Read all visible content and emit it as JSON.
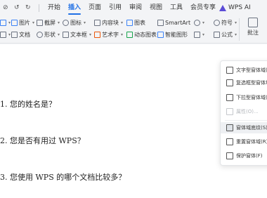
{
  "tabbar": {
    "quick_access": [
      "⊘",
      "↺",
      "↻"
    ],
    "tabs": [
      {
        "label": "开始",
        "active": false
      },
      {
        "label": "插入",
        "active": true
      },
      {
        "label": "页面",
        "active": false
      },
      {
        "label": "引用",
        "active": false
      },
      {
        "label": "审阅",
        "active": false
      },
      {
        "label": "视图",
        "active": false
      },
      {
        "label": "工具",
        "active": false
      },
      {
        "label": "会员专享",
        "active": false
      }
    ],
    "ai_label": "WPS AI"
  },
  "ribbon": {
    "picture": "图片",
    "screenshot": "截屏",
    "icons": "图标",
    "content_library": "内容块",
    "chart": "图表",
    "smartart": "SmartArt",
    "file": "文档",
    "shapes": "形状",
    "textbox": "文本框",
    "wordart": "艺术字",
    "dynamic_chart": "动态图表",
    "smart_graphic": "智能图形",
    "symbol": "符号",
    "formula": "公式",
    "comment": "批注"
  },
  "document": {
    "questions": [
      "1. 您的姓名是？",
      "2. 您是否有用过 WPS？",
      "3. 您使用 WPS 的哪个文档比较多？"
    ]
  },
  "menu": {
    "items": [
      {
        "label": "文字型窗体域(T)",
        "icon": "text-field-icon",
        "disabled": false,
        "highlighted": false
      },
      {
        "label": "复选框型窗体域(C)",
        "icon": "checkbox-field-icon",
        "disabled": false,
        "highlighted": false
      },
      {
        "label": "下拉型窗体域(D)",
        "icon": "dropdown-field-icon",
        "disabled": false,
        "highlighted": false
      },
      {
        "label": "属性(O)...",
        "icon": "properties-icon",
        "disabled": true,
        "highlighted": false
      },
      {
        "label": "窗体域底纹(S)",
        "icon": "shading-icon",
        "disabled": false,
        "highlighted": true
      },
      {
        "label": "重置窗体域(R)",
        "icon": "reset-icon",
        "disabled": false,
        "highlighted": false
      },
      {
        "label": "保护窗体(F)",
        "icon": "lock-icon",
        "disabled": false,
        "highlighted": false
      }
    ]
  },
  "colors": {
    "accent": "#1f6fe5",
    "ai": "#5b4bd6",
    "ribbon_bg": "#f3f4f6",
    "page_bg": "#ffffff"
  }
}
